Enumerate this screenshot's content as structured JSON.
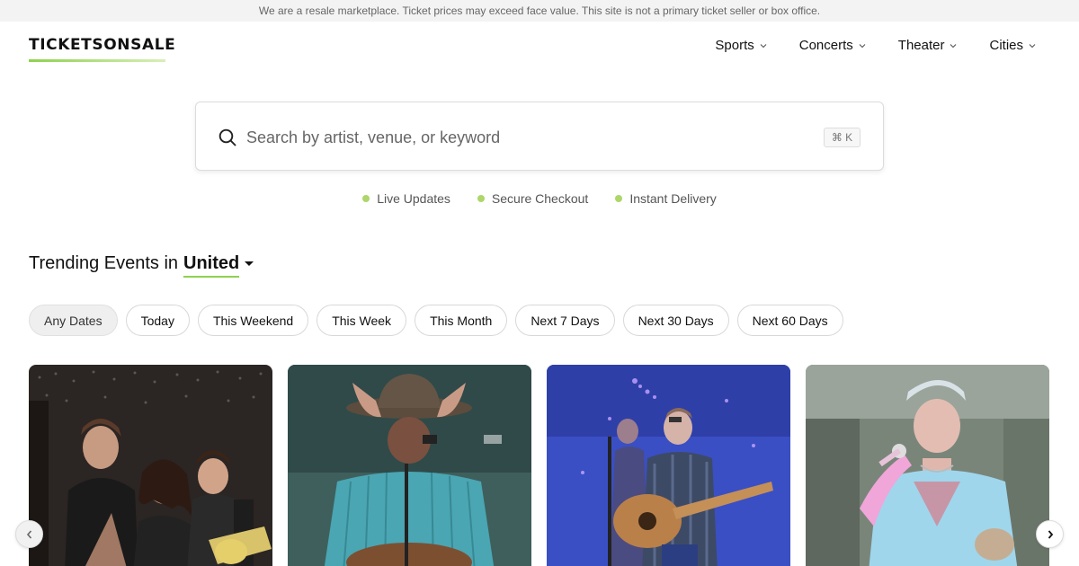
{
  "disclaimer": "We are a resale marketplace. Ticket prices may exceed face value. This site is not a primary ticket seller or box office.",
  "brand": {
    "name": "TICKETSONSALE",
    "accent": "#8fd14f"
  },
  "nav": {
    "items": [
      {
        "label": "Sports",
        "icon": "chevron-down-icon"
      },
      {
        "label": "Concerts",
        "icon": "chevron-down-icon"
      },
      {
        "label": "Theater",
        "icon": "chevron-down-icon"
      },
      {
        "label": "Cities",
        "icon": "chevron-down-icon"
      }
    ]
  },
  "search": {
    "placeholder": "Search by artist, venue, or keyword",
    "value": "",
    "shortcut": "⌘ K",
    "icon": "search-icon"
  },
  "features": [
    {
      "label": "Live Updates"
    },
    {
      "label": "Secure Checkout"
    },
    {
      "label": "Instant Delivery"
    }
  ],
  "trending": {
    "prefix": "Trending Events in",
    "location": "United"
  },
  "date_filters": {
    "selected": "Any Dates",
    "options": [
      "Any Dates",
      "Today",
      "This Weekend",
      "This Week",
      "This Month",
      "Next 7 Days",
      "Next 30 Days",
      "Next 60 Days"
    ]
  },
  "carousel": {
    "prev_icon": "chevron-left-icon",
    "next_icon": "chevron-right-icon",
    "cards": [
      {
        "image": "band-group-photo"
      },
      {
        "image": "cowboy-hat-performer"
      },
      {
        "image": "guitarist-on-stage"
      },
      {
        "image": "singer-with-microphone"
      }
    ]
  }
}
